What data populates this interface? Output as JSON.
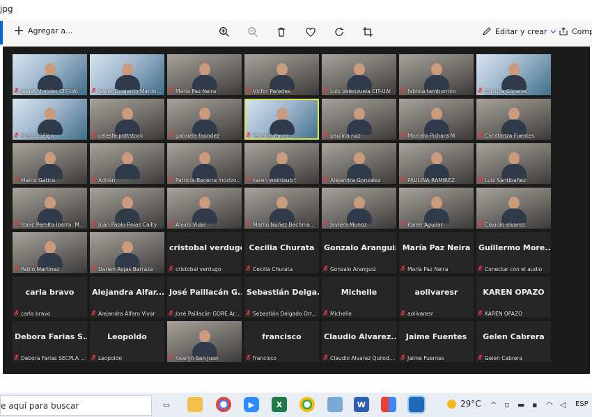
{
  "window": {
    "title": "jpg"
  },
  "toolbar": {
    "add_label": "Agregar a...",
    "edit_label": "Editar y crear",
    "share_label": "Comp"
  },
  "taskbar": {
    "search_text": "e aquí para buscar",
    "temperature": "29°C",
    "language": "ESP"
  },
  "participants": [
    {
      "name": "Javier Morales CIT-UAI",
      "big": "",
      "kind": "slide"
    },
    {
      "name": "Javier Guajardo Mardo...",
      "big": "",
      "kind": "slide"
    },
    {
      "name": "María Paz Neira",
      "big": "",
      "kind": "video"
    },
    {
      "name": "Víctor Paredes",
      "big": "",
      "kind": "video"
    },
    {
      "name": "Luis Valenzuela CIT-UAI",
      "big": "",
      "kind": "video"
    },
    {
      "name": "fabiola tamburrino",
      "big": "",
      "kind": "video"
    },
    {
      "name": "Cristina Cáceres",
      "big": "",
      "kind": "slide"
    },
    {
      "name": "Sofía Zúñiga",
      "big": "",
      "kind": "slide"
    },
    {
      "name": "celeste pottstock",
      "big": "",
      "kind": "video"
    },
    {
      "name": "gabriela faúndez",
      "big": "",
      "kind": "video"
    },
    {
      "name": "Yairoby Yanez",
      "big": "",
      "kind": "slide",
      "active": true
    },
    {
      "name": "paulina.ruiz",
      "big": "",
      "kind": "video"
    },
    {
      "name": "Marcelo Pichara M",
      "big": "",
      "kind": "video"
    },
    {
      "name": "Constanza Fuentes",
      "big": "",
      "kind": "video"
    },
    {
      "name": "Marco Gatica",
      "big": "",
      "kind": "video"
    },
    {
      "name": "Adrián",
      "big": "",
      "kind": "video"
    },
    {
      "name": "Patricia Becerra Inostro...",
      "big": "",
      "kind": "video"
    },
    {
      "name": "karen weinlaub t",
      "big": "",
      "kind": "video"
    },
    {
      "name": "Alejandra Gonzalez",
      "big": "",
      "kind": "video"
    },
    {
      "name": "PAULINA RAMIREZ",
      "big": "",
      "kind": "video"
    },
    {
      "name": "Luis Santibañez",
      "big": "",
      "kind": "video"
    },
    {
      "name": "Isaac Peralta Ibarra. M...",
      "big": "",
      "kind": "video"
    },
    {
      "name": "Juan Pablo Rojas Cailly",
      "big": "",
      "kind": "video"
    },
    {
      "name": "Alexis Vidal",
      "big": "",
      "kind": "video"
    },
    {
      "name": "Marilú Núñez Bachma...",
      "big": "",
      "kind": "video"
    },
    {
      "name": "Javiera Munoz",
      "big": "",
      "kind": "video"
    },
    {
      "name": "Karen Aguilar",
      "big": "",
      "kind": "video"
    },
    {
      "name": "Claudio alvarez",
      "big": "",
      "kind": "video"
    },
    {
      "name": "Pablo Martínez",
      "big": "",
      "kind": "video"
    },
    {
      "name": "Darien Rojas Barraza",
      "big": "",
      "kind": "video"
    },
    {
      "name": "cristobal verdugo",
      "big": "cristobal verdugo",
      "kind": "name"
    },
    {
      "name": "Cecilia Churata",
      "big": "Cecilia Churata",
      "kind": "name"
    },
    {
      "name": "Gonzalo Aranguiz",
      "big": "Gonzalo Aranguiz",
      "kind": "name"
    },
    {
      "name": "María Paz Neira",
      "big": "María Paz Neira",
      "kind": "name"
    },
    {
      "name": "Conectar con el audio",
      "big": "Guillermo More...",
      "kind": "name"
    },
    {
      "name": "carla bravo",
      "big": "carla bravo",
      "kind": "name"
    },
    {
      "name": "Alejandra Alfaro Vivar",
      "big": "Alejandra Alfar...",
      "kind": "name"
    },
    {
      "name": "José Paillacán GORE Ar...",
      "big": "José Paillacán G...",
      "kind": "name"
    },
    {
      "name": "Sebastián Delgado Orr...",
      "big": "Sebastián Delga...",
      "kind": "name"
    },
    {
      "name": "Michelle",
      "big": "Michelle",
      "kind": "name"
    },
    {
      "name": "aolivaresr",
      "big": "aolivaresr",
      "kind": "name"
    },
    {
      "name": "KAREN OPAZO",
      "big": "KAREN OPAZO",
      "kind": "name"
    },
    {
      "name": "Debora Farias SECPLA ...",
      "big": "Debora Farias S...",
      "kind": "name"
    },
    {
      "name": "Leopoldo",
      "big": "Leopoldo",
      "kind": "name"
    },
    {
      "name": "Joselyn San Juan",
      "big": "",
      "kind": "photo"
    },
    {
      "name": "francisco",
      "big": "francisco",
      "kind": "name"
    },
    {
      "name": "Claudio Alvarez Quilod...",
      "big": "Claudio Alvarez...",
      "kind": "name"
    },
    {
      "name": "Jaime Fuentes",
      "big": "Jaime Fuentes",
      "kind": "name"
    },
    {
      "name": "Gelen Cabrera",
      "big": "Gelen Cabrera",
      "kind": "name"
    }
  ]
}
